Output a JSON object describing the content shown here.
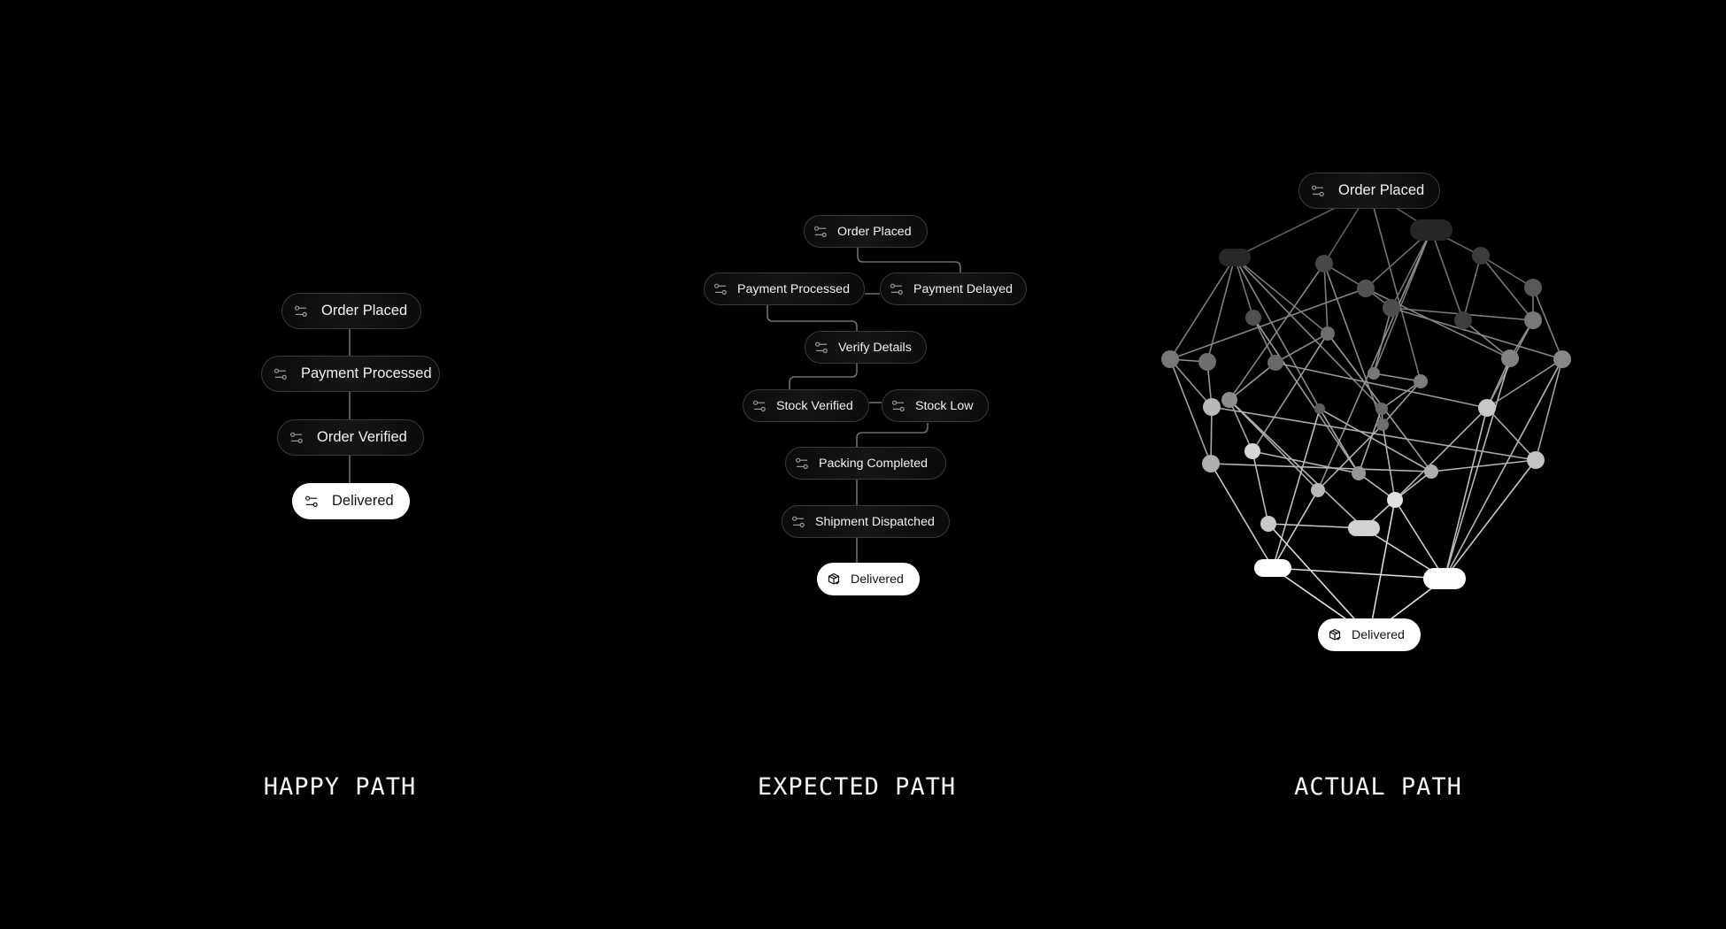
{
  "colors": {
    "background": "#000000",
    "pill_dark": "#111111",
    "pill_border": "#3a3a3a",
    "pill_light": "#ffffff",
    "connector": "#7a7a7a",
    "caption": "#f4f4f4"
  },
  "happy_path": {
    "caption": "HAPPY PATH",
    "nodes": [
      {
        "id": "order-placed",
        "label": "Order Placed",
        "icon": "sliders-icon",
        "style": "dark"
      },
      {
        "id": "payment-processed",
        "label": "Payment Processed",
        "icon": "sliders-icon",
        "style": "dark"
      },
      {
        "id": "order-verified",
        "label": "Order Verified",
        "icon": "sliders-icon",
        "style": "dark"
      },
      {
        "id": "delivered",
        "label": "Delivered",
        "icon": "sliders-icon",
        "style": "light"
      }
    ],
    "edges": [
      [
        "order-placed",
        "payment-processed"
      ],
      [
        "payment-processed",
        "order-verified"
      ],
      [
        "order-verified",
        "delivered"
      ]
    ]
  },
  "expected_path": {
    "caption": "EXPECTED PATH",
    "nodes": [
      {
        "id": "order-placed",
        "label": "Order Placed",
        "icon": "sliders-icon",
        "style": "dark"
      },
      {
        "id": "payment-processed",
        "label": "Payment Processed",
        "icon": "sliders-icon",
        "style": "dark"
      },
      {
        "id": "payment-delayed",
        "label": "Payment Delayed",
        "icon": "sliders-icon",
        "style": "dark"
      },
      {
        "id": "verify-details",
        "label": "Verify Details",
        "icon": "sliders-icon",
        "style": "dark"
      },
      {
        "id": "stock-verified",
        "label": "Stock Verified",
        "icon": "sliders-icon",
        "style": "dark"
      },
      {
        "id": "stock-low",
        "label": "Stock Low",
        "icon": "sliders-icon",
        "style": "dark"
      },
      {
        "id": "packing-completed",
        "label": "Packing Completed",
        "icon": "sliders-icon",
        "style": "dark"
      },
      {
        "id": "shipment-dispatched",
        "label": "Shipment Dispatched",
        "icon": "sliders-icon",
        "style": "dark"
      },
      {
        "id": "delivered",
        "label": "Delivered",
        "icon": "package-icon",
        "style": "light"
      }
    ],
    "edges": [
      [
        "order-placed",
        "payment-delayed"
      ],
      [
        "payment-processed",
        "payment-delayed"
      ],
      [
        "payment-processed",
        "verify-details"
      ],
      [
        "verify-details",
        "stock-verified"
      ],
      [
        "stock-verified",
        "stock-low"
      ],
      [
        "stock-low",
        "packing-completed"
      ],
      [
        "packing-completed",
        "shipment-dispatched"
      ],
      [
        "shipment-dispatched",
        "delivered"
      ]
    ]
  },
  "actual_path": {
    "caption": "ACTUAL PATH",
    "start": {
      "label": "Order Placed",
      "icon": "sliders-icon",
      "style": "dark"
    },
    "end": {
      "label": "Delivered",
      "icon": "package-icon",
      "style": "light"
    },
    "unlabeled_node_count": 33,
    "edges": [
      [
        "start",
        "A"
      ],
      [
        "start",
        "C"
      ],
      [
        "start",
        "B"
      ],
      [
        "start",
        "P"
      ],
      [
        "A",
        "L"
      ],
      [
        "A",
        "M"
      ],
      [
        "A",
        "H"
      ],
      [
        "A",
        "K"
      ],
      [
        "A",
        "U"
      ],
      [
        "A",
        "V"
      ],
      [
        "B",
        "E"
      ],
      [
        "B",
        "F"
      ],
      [
        "B",
        "D"
      ],
      [
        "B",
        "O"
      ],
      [
        "B",
        "I"
      ],
      [
        "B",
        "b"
      ],
      [
        "C",
        "E"
      ],
      [
        "C",
        "K"
      ],
      [
        "C",
        "T"
      ],
      [
        "C",
        "W"
      ],
      [
        "D",
        "I"
      ],
      [
        "D",
        "J"
      ],
      [
        "D",
        "G"
      ],
      [
        "E",
        "L"
      ],
      [
        "E",
        "F"
      ],
      [
        "E",
        "Q"
      ],
      [
        "F",
        "J"
      ],
      [
        "F",
        "R"
      ],
      [
        "F",
        "O"
      ],
      [
        "G",
        "J"
      ],
      [
        "G",
        "R"
      ],
      [
        "H",
        "N"
      ],
      [
        "H",
        "a"
      ],
      [
        "I",
        "Q"
      ],
      [
        "J",
        "Q"
      ],
      [
        "J",
        "X"
      ],
      [
        "K",
        "N"
      ],
      [
        "K",
        "Y"
      ],
      [
        "K",
        "c"
      ],
      [
        "L",
        "M"
      ],
      [
        "L",
        "S"
      ],
      [
        "L",
        "Z"
      ],
      [
        "M",
        "S"
      ],
      [
        "N",
        "T"
      ],
      [
        "N",
        "X"
      ],
      [
        "O",
        "P"
      ],
      [
        "P",
        "W"
      ],
      [
        "P",
        "V"
      ],
      [
        "Q",
        "X"
      ],
      [
        "Q",
        "i"
      ],
      [
        "R",
        "X"
      ],
      [
        "R",
        "d"
      ],
      [
        "R",
        "i"
      ],
      [
        "S",
        "Z"
      ],
      [
        "S",
        "d"
      ],
      [
        "T",
        "Y"
      ],
      [
        "T",
        "b"
      ],
      [
        "T",
        "g"
      ],
      [
        "U",
        "a"
      ],
      [
        "U",
        "h"
      ],
      [
        "U",
        "c"
      ],
      [
        "V",
        "W"
      ],
      [
        "V",
        "a"
      ],
      [
        "W",
        "b"
      ],
      [
        "W",
        "e"
      ],
      [
        "X",
        "e"
      ],
      [
        "X",
        "i"
      ],
      [
        "X",
        "d"
      ],
      [
        "Y",
        "f"
      ],
      [
        "Y",
        "a"
      ],
      [
        "Z",
        "h"
      ],
      [
        "Z",
        "c"
      ],
      [
        "a",
        "e"
      ],
      [
        "b",
        "h"
      ],
      [
        "c",
        "d"
      ],
      [
        "c",
        "e"
      ],
      [
        "d",
        "i"
      ],
      [
        "e",
        "g"
      ],
      [
        "e",
        "i"
      ],
      [
        "e",
        "end"
      ],
      [
        "f",
        "g"
      ],
      [
        "f",
        "end"
      ],
      [
        "g",
        "i"
      ],
      [
        "h",
        "i"
      ],
      [
        "h",
        "end"
      ],
      [
        "i",
        "end"
      ]
    ]
  }
}
